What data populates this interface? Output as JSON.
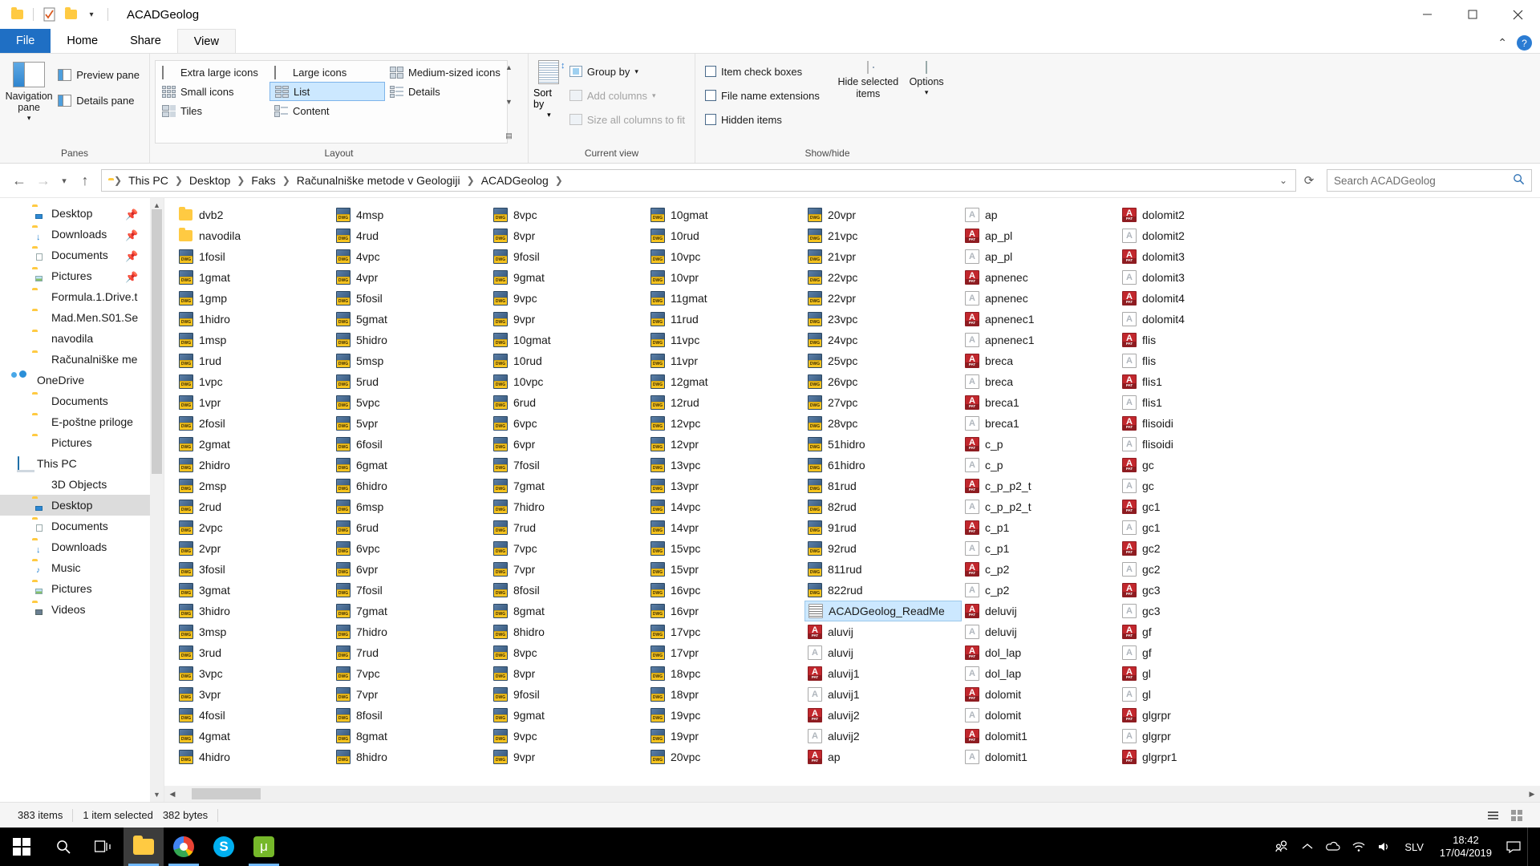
{
  "window": {
    "title": "ACADGeolog",
    "quick_access_icons": [
      "folder-icon",
      "properties-checkbox-icon",
      "new-folder-icon",
      "customize-dropdown-icon"
    ],
    "controls": {
      "minimize": "—",
      "maximize": "❐",
      "close": "✕"
    }
  },
  "ribbon": {
    "tabs": [
      {
        "label": "File",
        "active": false,
        "type": "file"
      },
      {
        "label": "Home",
        "active": false
      },
      {
        "label": "Share",
        "active": false
      },
      {
        "label": "View",
        "active": true
      }
    ],
    "collapse_icon": "chevron-up-icon",
    "help_icon": "help-icon",
    "groups": [
      {
        "label": "Panes",
        "big_button": {
          "label": "Navigation pane",
          "icon": "navigation-pane-icon",
          "has_dropdown": true
        },
        "items": [
          {
            "label": "Preview pane",
            "icon": "preview-pane-icon",
            "disabled": false
          },
          {
            "label": "Details pane",
            "icon": "details-pane-icon",
            "disabled": false
          }
        ]
      },
      {
        "label": "Layout",
        "views": [
          {
            "label": "Extra large icons",
            "selected": false
          },
          {
            "label": "Large icons",
            "selected": false
          },
          {
            "label": "Medium-sized icons",
            "selected": false
          },
          {
            "label": "Small icons",
            "selected": false
          },
          {
            "label": "List",
            "selected": true
          },
          {
            "label": "Details",
            "selected": false
          },
          {
            "label": "Tiles",
            "selected": false
          },
          {
            "label": "Content",
            "selected": false
          }
        ]
      },
      {
        "label": "Current view",
        "sort_by": {
          "label": "Sort by",
          "icon": "sort-icon"
        },
        "items": [
          {
            "label": "Group by",
            "icon": "group-by-icon",
            "disabled": false
          },
          {
            "label": "Add columns",
            "icon": "add-columns-icon",
            "disabled": true
          },
          {
            "label": "Size all columns to fit",
            "icon": "size-columns-icon",
            "disabled": true
          }
        ]
      },
      {
        "label": "Show/hide",
        "checkboxes": [
          {
            "label": "Item check boxes",
            "checked": false
          },
          {
            "label": "File name extensions",
            "checked": false
          },
          {
            "label": "Hidden items",
            "checked": false
          }
        ],
        "hide_selected": {
          "label": "Hide selected items",
          "icon": "hide-items-icon"
        },
        "options": {
          "label": "Options",
          "icon": "options-icon",
          "has_dropdown": true
        }
      }
    ]
  },
  "address_bar": {
    "back_icon": "back-arrow-icon",
    "forward_icon": "forward-arrow-icon",
    "recent_icon": "recent-locations-icon",
    "up_icon": "up-arrow-icon",
    "folder_icon": "folder-icon",
    "breadcrumbs": [
      "This PC",
      "Desktop",
      "Faks",
      "Računalniške metode v Geologiji",
      "ACADGeolog"
    ],
    "dropdown_icon": "chevron-down-icon",
    "search_placeholder": "Search ACADGeolog",
    "search_value": "",
    "search_icon": "search-icon"
  },
  "nav_pane": {
    "items": [
      {
        "label": "Desktop",
        "icon": "desktop-folder-icon",
        "indent": 1,
        "pinned": true,
        "selected": false
      },
      {
        "label": "Downloads",
        "icon": "downloads-folder-icon",
        "indent": 1,
        "pinned": true,
        "selected": false
      },
      {
        "label": "Documents",
        "icon": "documents-folder-icon",
        "indent": 1,
        "pinned": true,
        "selected": false
      },
      {
        "label": "Pictures",
        "icon": "pictures-folder-icon",
        "indent": 1,
        "pinned": true,
        "selected": false
      },
      {
        "label": "Formula.1.Drive.t",
        "icon": "folder-icon",
        "indent": 1,
        "pinned": false,
        "selected": false
      },
      {
        "label": "Mad.Men.S01.Se",
        "icon": "folder-icon",
        "indent": 1,
        "pinned": false,
        "selected": false
      },
      {
        "label": "navodila",
        "icon": "folder-icon",
        "indent": 1,
        "pinned": false,
        "selected": false
      },
      {
        "label": "Računalniške me",
        "icon": "folder-icon",
        "indent": 1,
        "pinned": false,
        "selected": false
      },
      {
        "label": "OneDrive",
        "icon": "onedrive-cloud-icon",
        "indent": 0,
        "pinned": false,
        "selected": false
      },
      {
        "label": "Documents",
        "icon": "folder-icon",
        "indent": 1,
        "pinned": false,
        "selected": false
      },
      {
        "label": "E-poštne priloge",
        "icon": "folder-icon",
        "indent": 1,
        "pinned": false,
        "selected": false
      },
      {
        "label": "Pictures",
        "icon": "folder-icon",
        "indent": 1,
        "pinned": false,
        "selected": false
      },
      {
        "label": "This PC",
        "icon": "this-pc-icon",
        "indent": 0,
        "pinned": false,
        "selected": false
      },
      {
        "label": "3D Objects",
        "icon": "3d-objects-icon",
        "indent": 1,
        "pinned": false,
        "selected": false
      },
      {
        "label": "Desktop",
        "icon": "desktop-folder-icon",
        "indent": 1,
        "pinned": false,
        "selected": true
      },
      {
        "label": "Documents",
        "icon": "documents-folder-icon",
        "indent": 1,
        "pinned": false,
        "selected": false
      },
      {
        "label": "Downloads",
        "icon": "downloads-folder-icon",
        "indent": 1,
        "pinned": false,
        "selected": false
      },
      {
        "label": "Music",
        "icon": "music-folder-icon",
        "indent": 1,
        "pinned": false,
        "selected": false
      },
      {
        "label": "Pictures",
        "icon": "pictures-folder-icon",
        "indent": 1,
        "pinned": false,
        "selected": false
      },
      {
        "label": "Videos",
        "icon": "videos-folder-icon",
        "indent": 1,
        "pinned": false,
        "selected": false
      }
    ]
  },
  "files": [
    {
      "name": "dvb2",
      "type": "folder"
    },
    {
      "name": "navodila",
      "type": "folder"
    },
    {
      "name": "1fosil",
      "type": "dwg"
    },
    {
      "name": "1gmat",
      "type": "dwg"
    },
    {
      "name": "1gmp",
      "type": "dwg"
    },
    {
      "name": "1hidro",
      "type": "dwg"
    },
    {
      "name": "1msp",
      "type": "dwg"
    },
    {
      "name": "1rud",
      "type": "dwg"
    },
    {
      "name": "1vpc",
      "type": "dwg"
    },
    {
      "name": "1vpr",
      "type": "dwg"
    },
    {
      "name": "2fosil",
      "type": "dwg"
    },
    {
      "name": "2gmat",
      "type": "dwg"
    },
    {
      "name": "2hidro",
      "type": "dwg"
    },
    {
      "name": "2msp",
      "type": "dwg"
    },
    {
      "name": "2rud",
      "type": "dwg"
    },
    {
      "name": "2vpc",
      "type": "dwg"
    },
    {
      "name": "2vpr",
      "type": "dwg"
    },
    {
      "name": "3fosil",
      "type": "dwg"
    },
    {
      "name": "3gmat",
      "type": "dwg"
    },
    {
      "name": "3hidro",
      "type": "dwg"
    },
    {
      "name": "3msp",
      "type": "dwg"
    },
    {
      "name": "3rud",
      "type": "dwg"
    },
    {
      "name": "3vpc",
      "type": "dwg"
    },
    {
      "name": "3vpr",
      "type": "dwg"
    },
    {
      "name": "4fosil",
      "type": "dwg"
    },
    {
      "name": "4gmat",
      "type": "dwg"
    },
    {
      "name": "4hidro",
      "type": "dwg"
    },
    {
      "name": "4msp",
      "type": "dwg"
    },
    {
      "name": "4rud",
      "type": "dwg"
    },
    {
      "name": "4vpc",
      "type": "dwg"
    },
    {
      "name": "4vpr",
      "type": "dwg"
    },
    {
      "name": "5fosil",
      "type": "dwg"
    },
    {
      "name": "5gmat",
      "type": "dwg"
    },
    {
      "name": "5hidro",
      "type": "dwg"
    },
    {
      "name": "5msp",
      "type": "dwg"
    },
    {
      "name": "5rud",
      "type": "dwg"
    },
    {
      "name": "5vpc",
      "type": "dwg"
    },
    {
      "name": "5vpr",
      "type": "dwg"
    },
    {
      "name": "6fosil",
      "type": "dwg"
    },
    {
      "name": "6gmat",
      "type": "dwg"
    },
    {
      "name": "6hidro",
      "type": "dwg"
    },
    {
      "name": "6msp",
      "type": "dwg"
    },
    {
      "name": "6rud",
      "type": "dwg"
    },
    {
      "name": "6vpc",
      "type": "dwg"
    },
    {
      "name": "6vpr",
      "type": "dwg"
    },
    {
      "name": "7fosil",
      "type": "dwg"
    },
    {
      "name": "7gmat",
      "type": "dwg"
    },
    {
      "name": "7hidro",
      "type": "dwg"
    },
    {
      "name": "7rud",
      "type": "dwg"
    },
    {
      "name": "7vpc",
      "type": "dwg"
    },
    {
      "name": "7vpr",
      "type": "dwg"
    },
    {
      "name": "8fosil",
      "type": "dwg"
    },
    {
      "name": "8gmat",
      "type": "dwg"
    },
    {
      "name": "8hidro",
      "type": "dwg"
    },
    {
      "name": "8vpc",
      "type": "dwg"
    },
    {
      "name": "8vpr",
      "type": "dwg"
    },
    {
      "name": "9fosil",
      "type": "dwg"
    },
    {
      "name": "9gmat",
      "type": "dwg"
    },
    {
      "name": "9vpc",
      "type": "dwg"
    },
    {
      "name": "9vpr",
      "type": "dwg"
    },
    {
      "name": "10gmat",
      "type": "dwg"
    },
    {
      "name": "10rud",
      "type": "dwg"
    },
    {
      "name": "10vpc",
      "type": "dwg"
    },
    {
      "name": "6rud",
      "type": "dwg"
    },
    {
      "name": "6vpc",
      "type": "dwg"
    },
    {
      "name": "6vpr",
      "type": "dwg"
    },
    {
      "name": "7fosil",
      "type": "dwg"
    },
    {
      "name": "7gmat",
      "type": "dwg"
    },
    {
      "name": "7hidro",
      "type": "dwg"
    },
    {
      "name": "7rud",
      "type": "dwg"
    },
    {
      "name": "7vpc",
      "type": "dwg"
    },
    {
      "name": "7vpr",
      "type": "dwg"
    },
    {
      "name": "8fosil",
      "type": "dwg"
    },
    {
      "name": "8gmat",
      "type": "dwg"
    },
    {
      "name": "8hidro",
      "type": "dwg"
    },
    {
      "name": "8vpc",
      "type": "dwg"
    },
    {
      "name": "8vpr",
      "type": "dwg"
    },
    {
      "name": "9fosil",
      "type": "dwg"
    },
    {
      "name": "9gmat",
      "type": "dwg"
    },
    {
      "name": "9vpc",
      "type": "dwg"
    },
    {
      "name": "9vpr",
      "type": "dwg"
    },
    {
      "name": "10gmat",
      "type": "dwg"
    },
    {
      "name": "10rud",
      "type": "dwg"
    },
    {
      "name": "10vpc",
      "type": "dwg"
    },
    {
      "name": "10vpr",
      "type": "dwg"
    },
    {
      "name": "11gmat",
      "type": "dwg"
    },
    {
      "name": "11rud",
      "type": "dwg"
    },
    {
      "name": "11vpc",
      "type": "dwg"
    },
    {
      "name": "11vpr",
      "type": "dwg"
    },
    {
      "name": "12gmat",
      "type": "dwg"
    },
    {
      "name": "12rud",
      "type": "dwg"
    },
    {
      "name": "12vpc",
      "type": "dwg"
    },
    {
      "name": "12vpr",
      "type": "dwg"
    },
    {
      "name": "13vpc",
      "type": "dwg"
    },
    {
      "name": "13vpr",
      "type": "dwg"
    },
    {
      "name": "14vpc",
      "type": "dwg"
    },
    {
      "name": "14vpr",
      "type": "dwg"
    },
    {
      "name": "15vpc",
      "type": "dwg"
    },
    {
      "name": "15vpr",
      "type": "dwg"
    },
    {
      "name": "16vpc",
      "type": "dwg"
    },
    {
      "name": "16vpr",
      "type": "dwg"
    },
    {
      "name": "17vpc",
      "type": "dwg"
    },
    {
      "name": "17vpr",
      "type": "dwg"
    },
    {
      "name": "18vpc",
      "type": "dwg"
    },
    {
      "name": "18vpr",
      "type": "dwg"
    },
    {
      "name": "19vpc",
      "type": "dwg"
    },
    {
      "name": "19vpr",
      "type": "dwg"
    },
    {
      "name": "20vpc",
      "type": "dwg"
    },
    {
      "name": "20vpr",
      "type": "dwg"
    },
    {
      "name": "21vpc",
      "type": "dwg"
    },
    {
      "name": "21vpr",
      "type": "dwg"
    },
    {
      "name": "22vpc",
      "type": "dwg"
    },
    {
      "name": "22vpr",
      "type": "dwg"
    },
    {
      "name": "23vpc",
      "type": "dwg"
    },
    {
      "name": "24vpc",
      "type": "dwg"
    },
    {
      "name": "25vpc",
      "type": "dwg"
    },
    {
      "name": "26vpc",
      "type": "dwg"
    },
    {
      "name": "27vpc",
      "type": "dwg"
    },
    {
      "name": "28vpc",
      "type": "dwg"
    },
    {
      "name": "51hidro",
      "type": "dwg"
    },
    {
      "name": "61hidro",
      "type": "dwg"
    },
    {
      "name": "81rud",
      "type": "dwg"
    },
    {
      "name": "82rud",
      "type": "dwg"
    },
    {
      "name": "91rud",
      "type": "dwg"
    },
    {
      "name": "92rud",
      "type": "dwg"
    },
    {
      "name": "811rud",
      "type": "dwg"
    },
    {
      "name": "822rud",
      "type": "dwg"
    },
    {
      "name": "ACADGeolog_ReadMe",
      "type": "txt",
      "selected": true
    },
    {
      "name": "aluvij",
      "type": "pat"
    },
    {
      "name": "aluvij",
      "type": "gen"
    },
    {
      "name": "aluvij1",
      "type": "pat"
    },
    {
      "name": "aluvij1",
      "type": "gen"
    },
    {
      "name": "aluvij2",
      "type": "pat"
    },
    {
      "name": "aluvij2",
      "type": "gen"
    },
    {
      "name": "ap",
      "type": "pat"
    },
    {
      "name": "ap",
      "type": "gen"
    },
    {
      "name": "ap_pl",
      "type": "pat"
    },
    {
      "name": "ap_pl",
      "type": "gen"
    },
    {
      "name": "apnenec",
      "type": "pat"
    },
    {
      "name": "apnenec",
      "type": "gen"
    },
    {
      "name": "apnenec1",
      "type": "pat"
    },
    {
      "name": "apnenec1",
      "type": "gen"
    },
    {
      "name": "breca",
      "type": "pat"
    },
    {
      "name": "breca",
      "type": "gen"
    },
    {
      "name": "breca1",
      "type": "pat"
    },
    {
      "name": "breca1",
      "type": "gen"
    },
    {
      "name": "c_p",
      "type": "pat"
    },
    {
      "name": "c_p",
      "type": "gen"
    },
    {
      "name": "c_p_p2_t",
      "type": "pat"
    },
    {
      "name": "c_p_p2_t",
      "type": "gen"
    },
    {
      "name": "c_p1",
      "type": "pat"
    },
    {
      "name": "c_p1",
      "type": "gen"
    },
    {
      "name": "c_p2",
      "type": "pat"
    },
    {
      "name": "c_p2",
      "type": "gen"
    },
    {
      "name": "deluvij",
      "type": "pat"
    },
    {
      "name": "deluvij",
      "type": "gen"
    },
    {
      "name": "dol_lap",
      "type": "pat"
    },
    {
      "name": "dol_lap",
      "type": "gen"
    },
    {
      "name": "dolomit",
      "type": "pat"
    },
    {
      "name": "dolomit",
      "type": "gen"
    },
    {
      "name": "dolomit1",
      "type": "pat"
    },
    {
      "name": "dolomit1",
      "type": "gen"
    },
    {
      "name": "dolomit2",
      "type": "pat"
    },
    {
      "name": "dolomit2",
      "type": "gen"
    },
    {
      "name": "dolomit3",
      "type": "pat"
    },
    {
      "name": "dolomit3",
      "type": "gen"
    },
    {
      "name": "dolomit4",
      "type": "pat"
    },
    {
      "name": "dolomit4",
      "type": "gen"
    },
    {
      "name": "flis",
      "type": "pat"
    },
    {
      "name": "flis",
      "type": "gen"
    },
    {
      "name": "flis1",
      "type": "pat"
    },
    {
      "name": "flis1",
      "type": "gen"
    },
    {
      "name": "flisoidi",
      "type": "pat"
    },
    {
      "name": "flisoidi",
      "type": "gen"
    },
    {
      "name": "gc",
      "type": "pat"
    },
    {
      "name": "gc",
      "type": "gen"
    },
    {
      "name": "gc1",
      "type": "pat"
    },
    {
      "name": "gc1",
      "type": "gen"
    },
    {
      "name": "gc2",
      "type": "pat"
    },
    {
      "name": "gc2",
      "type": "gen"
    },
    {
      "name": "gc3",
      "type": "pat"
    },
    {
      "name": "gc3",
      "type": "gen"
    },
    {
      "name": "gf",
      "type": "pat"
    },
    {
      "name": "gf",
      "type": "gen"
    },
    {
      "name": "gl",
      "type": "pat"
    },
    {
      "name": "gl",
      "type": "gen"
    },
    {
      "name": "glgrpr",
      "type": "pat"
    },
    {
      "name": "glgrpr",
      "type": "gen"
    },
    {
      "name": "glgrpr1",
      "type": "pat"
    }
  ],
  "status_bar": {
    "item_count": "383 items",
    "selection": "1 item selected",
    "size": "382 bytes",
    "view_details_icon": "details-view-icon",
    "view_large_icon": "large-icons-view-icon"
  },
  "taskbar": {
    "start_icon": "windows-start-icon",
    "search_icon": "search-icon",
    "taskview_icon": "task-view-icon",
    "apps": [
      {
        "name": "File Explorer",
        "icon": "file-explorer-icon",
        "active": true
      },
      {
        "name": "Google Chrome",
        "icon": "chrome-icon",
        "active": true
      },
      {
        "name": "Skype",
        "icon": "skype-icon",
        "active": false
      },
      {
        "name": "uTorrent",
        "icon": "utorrent-icon",
        "active": true
      }
    ],
    "tray": [
      {
        "name": "people-icon"
      },
      {
        "name": "show-hidden-icons-chevron"
      },
      {
        "name": "onedrive-tray-icon"
      },
      {
        "name": "network-wifi-icon"
      },
      {
        "name": "volume-icon"
      }
    ],
    "language": "SLV",
    "time": "18:42",
    "date": "17/04/2019",
    "action_center_icon": "action-center-icon"
  }
}
